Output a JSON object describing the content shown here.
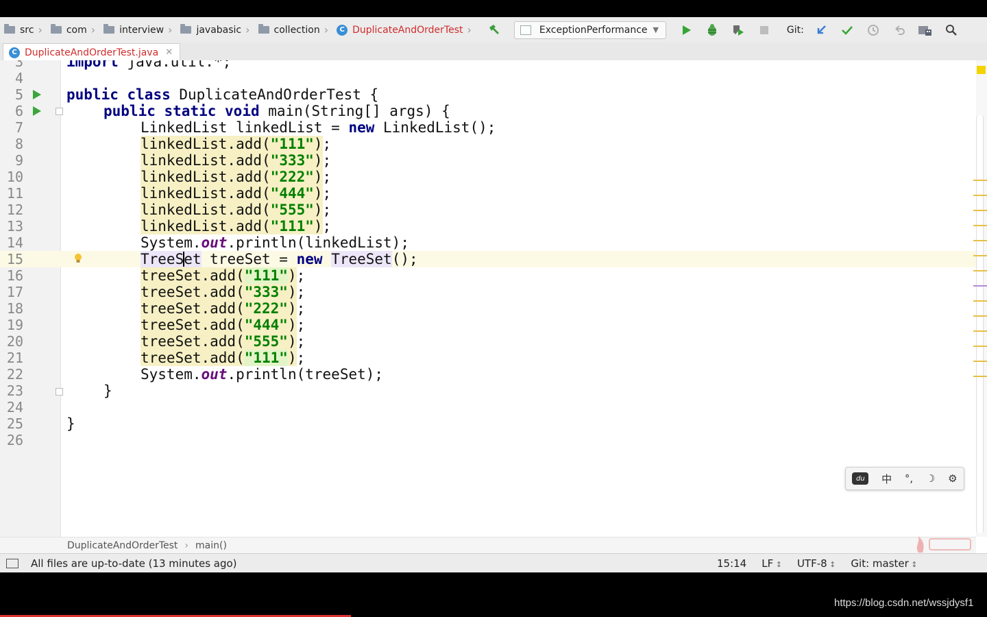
{
  "breadcrumbs": [
    "src",
    "com",
    "interview",
    "javabasic",
    "collection"
  ],
  "active_class": "DuplicateAndOrderTest",
  "class_icon_letter": "C",
  "run_config": "ExceptionPerformance",
  "git_label": "Git:",
  "file_tab": "DuplicateAndOrderTest.java",
  "line_numbers": [
    "3",
    "4",
    "5",
    "6",
    "7",
    "8",
    "9",
    "10",
    "11",
    "12",
    "13",
    "14",
    "15",
    "16",
    "17",
    "18",
    "19",
    "20",
    "21",
    "22",
    "23",
    "24",
    "25",
    "26"
  ],
  "code": {
    "l3": "import java.util.*;",
    "l5_kw1": "public",
    "l5_kw2": "class",
    "l5_rest": " DuplicateAndOrderTest {",
    "l6_kw1": "public",
    "l6_kw2": "static",
    "l6_kw3": "void",
    "l6_rest": " main(String[] args) {",
    "l7_a": "LinkedList linkedList = ",
    "l7_kw": "new",
    "l7_b": " LinkedList();",
    "linked_recv": "linkedList.add",
    "tree_recv": "treeSet.add",
    "values": [
      "\"111\"",
      "\"333\"",
      "\"222\"",
      "\"444\"",
      "\"555\"",
      "\"111\""
    ],
    "print_a": "System.",
    "print_out": "out",
    "print_linked": ".println(linkedList);",
    "print_tree": ".println(treeSet);",
    "l15_type1": "TreeSet",
    "l15_mid": " treeSet = ",
    "l15_kw": "new",
    "l15_type2": "TreeSet",
    "l15_end": "();",
    "close_inner": "}",
    "close_outer": "}"
  },
  "ime_items": [
    "du",
    "中",
    "°,",
    "☽",
    "⚙"
  ],
  "nav": {
    "class": "DuplicateAndOrderTest",
    "method": "main()"
  },
  "status": {
    "message": "All files are up-to-date (13 minutes ago)",
    "position": "15:14",
    "line_sep": "LF",
    "encoding": "UTF-8",
    "git_branch": "Git: master"
  },
  "watermark_url": "https://blog.csdn.net/wssjdysf1",
  "colors": {
    "keyword": "#000080",
    "string": "#008000",
    "active_file": "#d02c2c"
  }
}
